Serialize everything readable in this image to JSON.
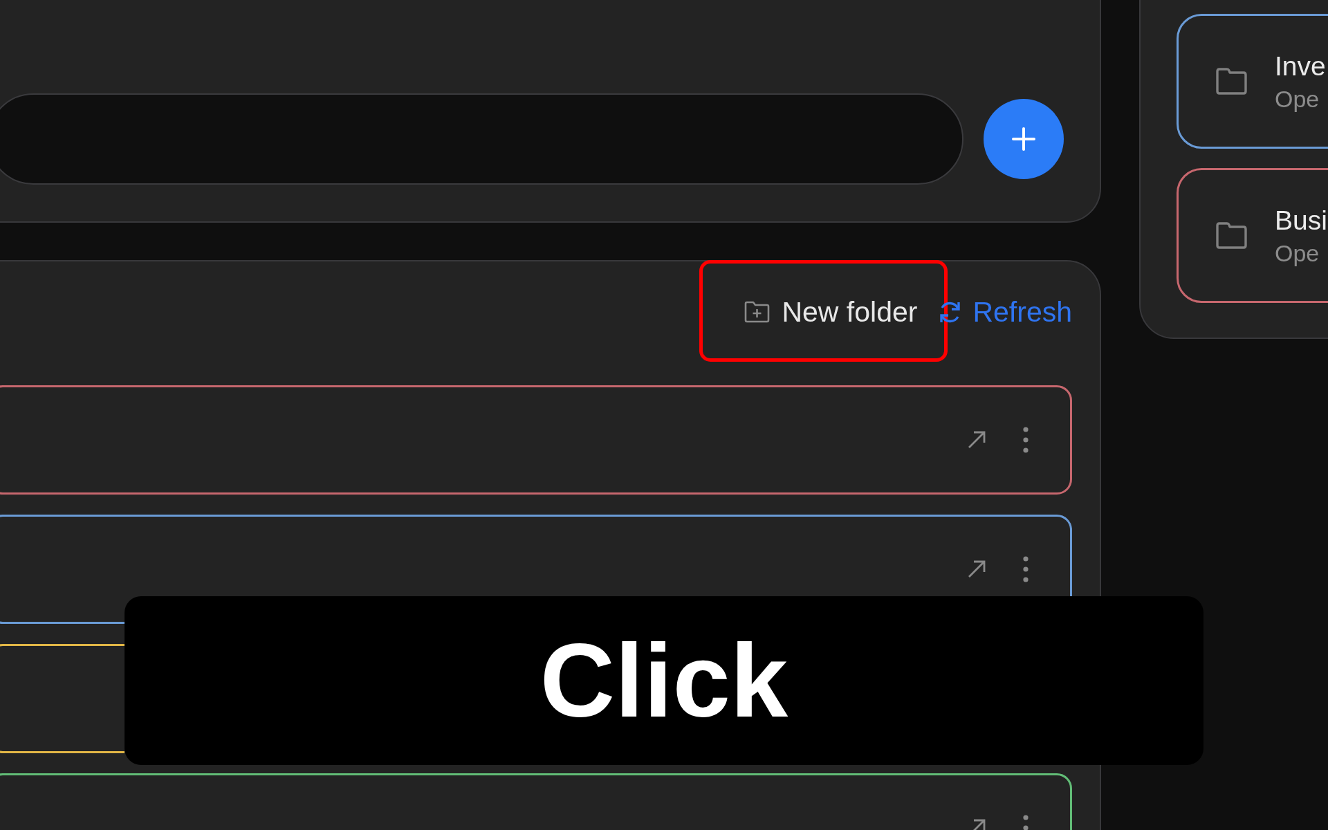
{
  "toolbar": {
    "buttons": [
      {
        "kind": "new_folder",
        "label": "New folder",
        "highlighted": true
      },
      {
        "kind": "refresh",
        "label": "Refresh",
        "highlighted": false
      }
    ]
  },
  "folders": [
    {
      "color": "#c7676e"
    },
    {
      "color": "#6a9bd6"
    },
    {
      "color": "#e1b646"
    },
    {
      "color": "#62bd77"
    }
  ],
  "side_panel": {
    "cards": [
      {
        "title": "Inve",
        "subtitle": "Ope",
        "color": "#6a9bd6"
      },
      {
        "title": "Busi",
        "subtitle": "Ope",
        "color": "#c7676e"
      }
    ]
  },
  "caption": {
    "text": "Click"
  }
}
